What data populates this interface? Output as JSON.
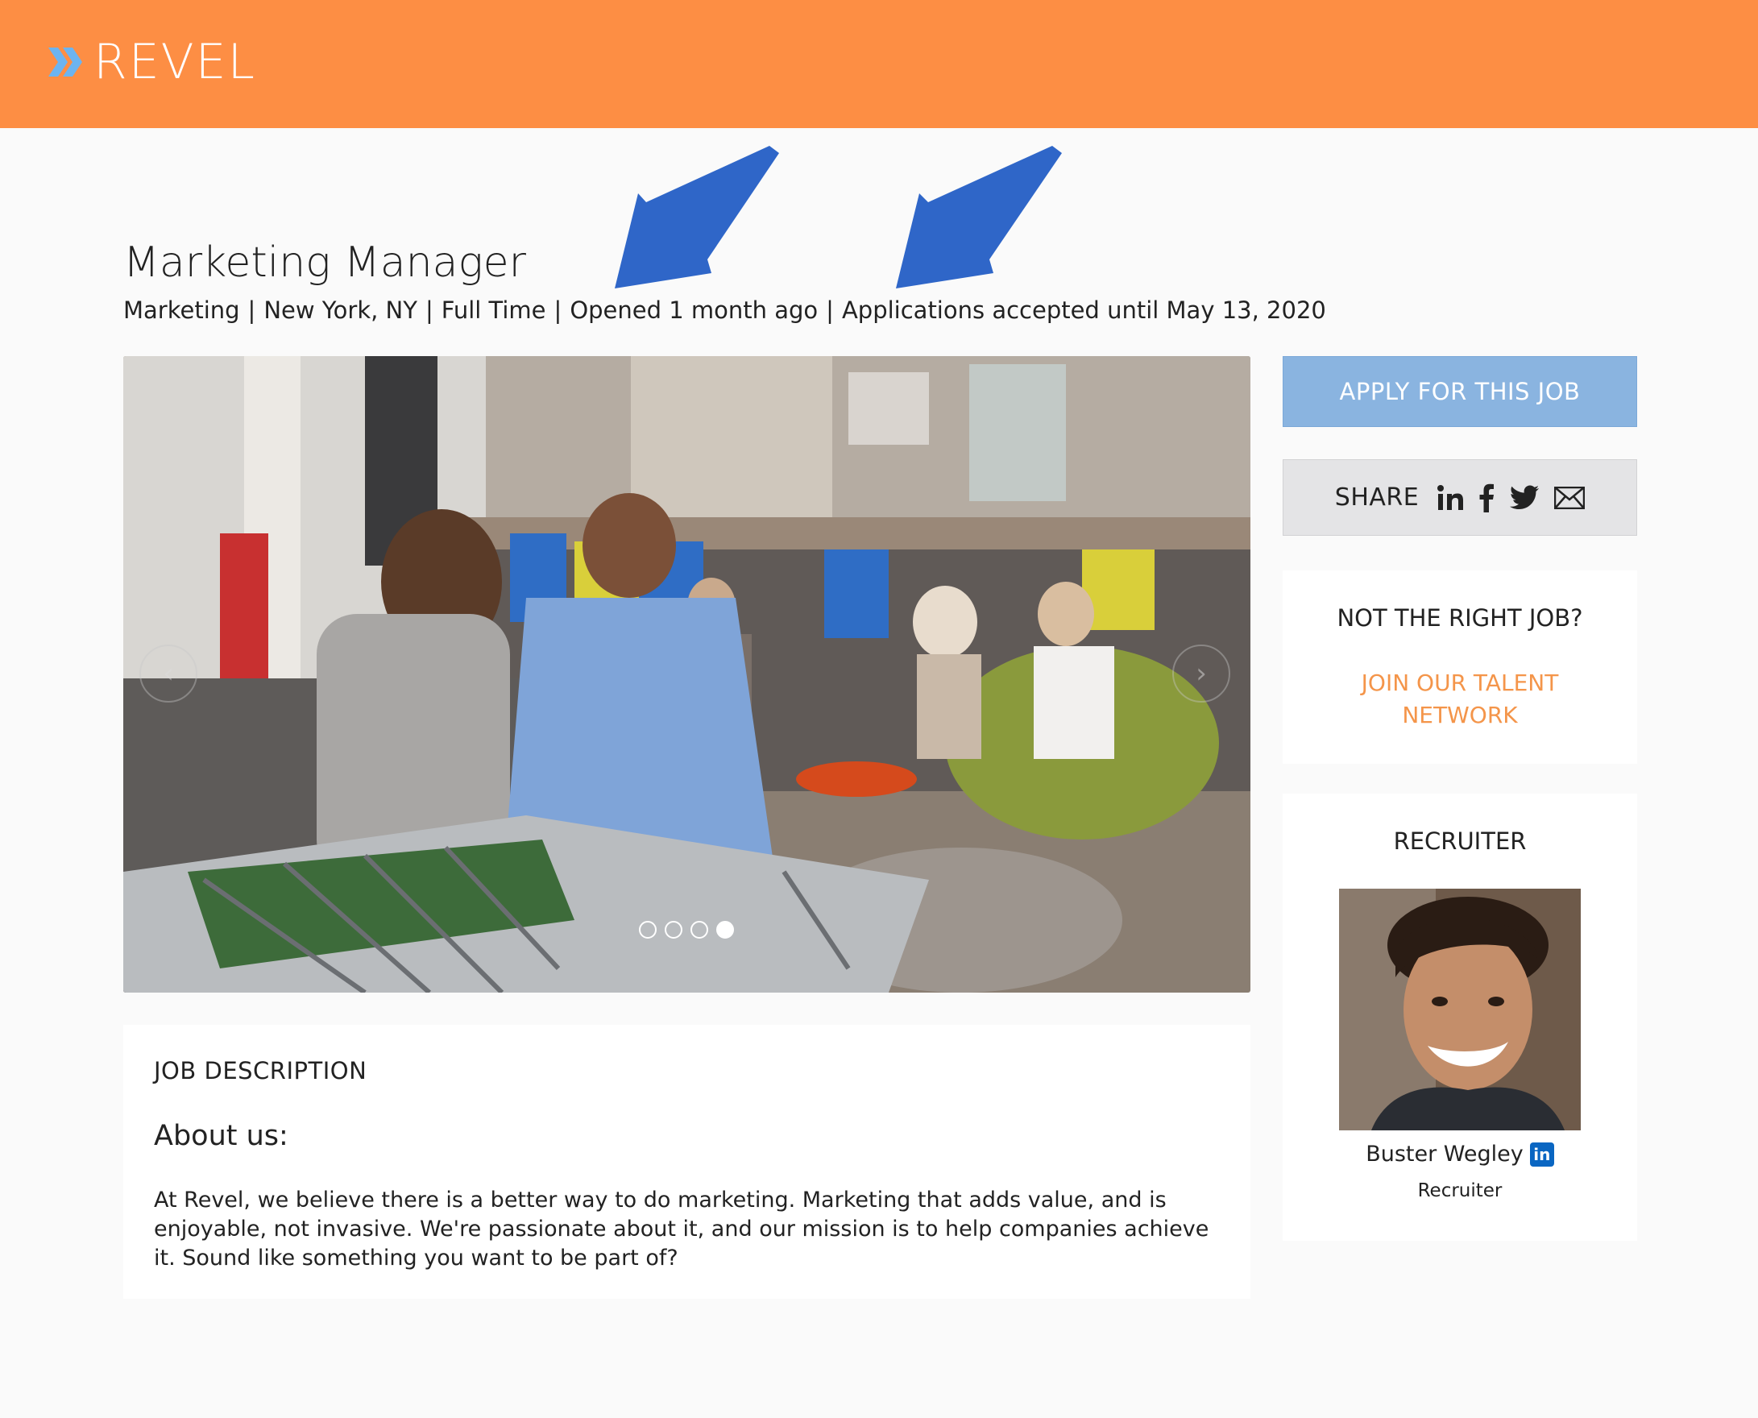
{
  "header": {
    "logo_text": "REVEL",
    "bg_color": "#fd8e44",
    "logo_accent": "#6cb4f0"
  },
  "job": {
    "title": "Marketing Manager",
    "department": "Marketing",
    "location": "New York, NY",
    "type": "Full Time",
    "opened": "Opened 1 month ago",
    "deadline": "Applications accepted until May 13, 2020",
    "separator": "|"
  },
  "carousel": {
    "slide_count": 4,
    "active_index": 3,
    "prev_icon": "chevron-left-icon",
    "next_icon": "chevron-right-icon"
  },
  "description": {
    "heading": "JOB DESCRIPTION",
    "subheading": "About us:",
    "body": "At Revel, we believe there is a better way to do marketing. Marketing that adds value, and is enjoyable, not invasive. We're passionate about it, and our mission is to help companies achieve it. Sound like something you want to be part of?"
  },
  "sidebar": {
    "apply_label": "APPLY FOR THIS JOB",
    "share_label": "SHARE",
    "share_icons": [
      "linkedin-icon",
      "facebook-icon",
      "twitter-icon",
      "email-icon"
    ],
    "not_right_heading": "NOT THE RIGHT JOB?",
    "talent_line1": "JOIN OUR TALENT",
    "talent_line2": "NETWORK",
    "recruiter_heading": "RECRUITER",
    "recruiter_name": "Buster Wegley",
    "recruiter_role": "Recruiter",
    "linkedin_badge": "in"
  },
  "colors": {
    "apply_button": "#8ab4e0",
    "talent_link": "#f4954a",
    "annotation_arrow": "#2f66c8"
  }
}
